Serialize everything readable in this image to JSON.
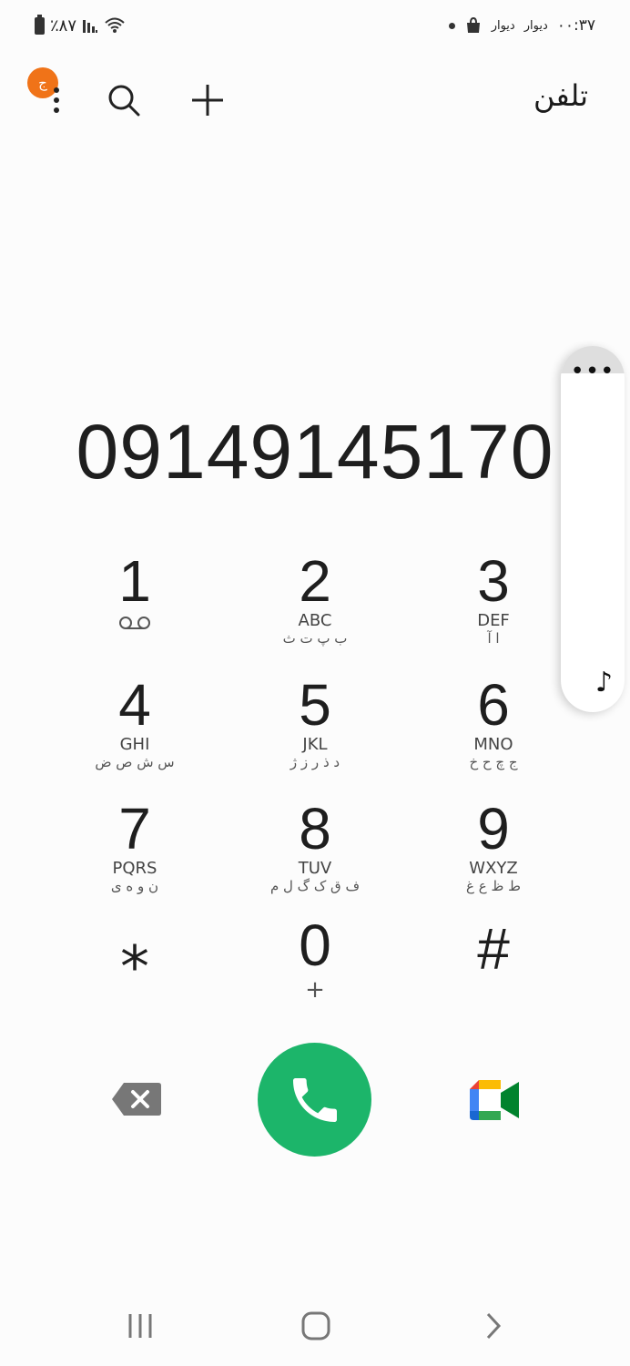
{
  "status_bar": {
    "battery_text": "٪۸۷",
    "time": "۰۰:۳۷",
    "notif_1": "دیوار",
    "notif_2": "دیوار"
  },
  "header": {
    "title": "تلفن",
    "badge_letter": "ج"
  },
  "dialer": {
    "number": "09149145170"
  },
  "keypad": {
    "k1": {
      "digit": "1",
      "latin": "",
      "arabic": ""
    },
    "k2": {
      "digit": "2",
      "latin": "ABC",
      "arabic": "ب پ ت ث"
    },
    "k3": {
      "digit": "3",
      "latin": "DEF",
      "arabic": "ا آ"
    },
    "k4": {
      "digit": "4",
      "latin": "GHI",
      "arabic": "س ش ص ض"
    },
    "k5": {
      "digit": "5",
      "latin": "JKL",
      "arabic": "د ذ ر ز ژ"
    },
    "k6": {
      "digit": "6",
      "latin": "MNO",
      "arabic": "ج چ ح خ"
    },
    "k7": {
      "digit": "7",
      "latin": "PQRS",
      "arabic": "ن و ه ی"
    },
    "k8": {
      "digit": "8",
      "latin": "TUV",
      "arabic": "ف ق ک گ ل م"
    },
    "k9": {
      "digit": "9",
      "latin": "WXYZ",
      "arabic": "ط ظ ع غ"
    },
    "kstar": {
      "digit": "⁎"
    },
    "k0": {
      "digit": "0",
      "sub": "+"
    },
    "khash": {
      "digit": "#"
    }
  },
  "side_panel": {
    "more": "•••",
    "note": "♪"
  },
  "colors": {
    "call": "#1cb56a",
    "badge": "#f07318"
  }
}
